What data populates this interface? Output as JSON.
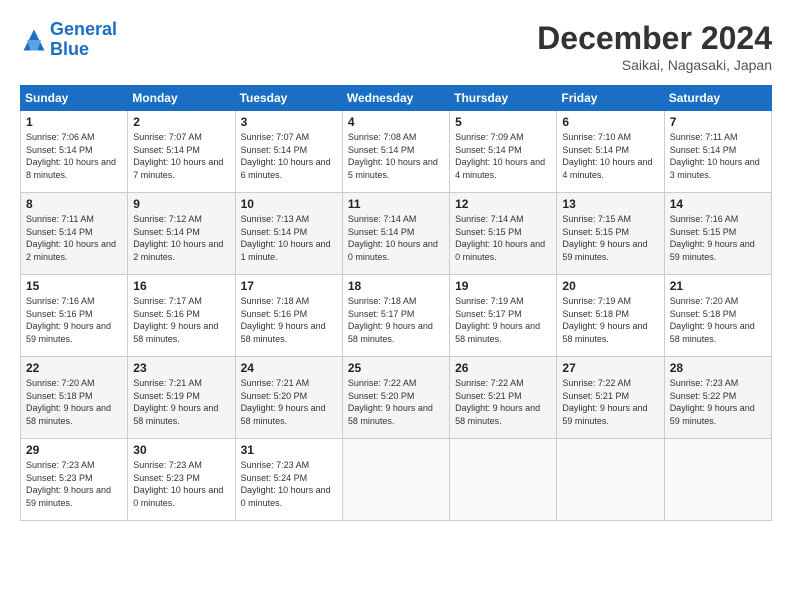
{
  "header": {
    "logo_line1": "General",
    "logo_line2": "Blue",
    "title": "December 2024",
    "location": "Saikai, Nagasaki, Japan"
  },
  "weekdays": [
    "Sunday",
    "Monday",
    "Tuesday",
    "Wednesday",
    "Thursday",
    "Friday",
    "Saturday"
  ],
  "weeks": [
    [
      {
        "day": "1",
        "sunrise": "Sunrise: 7:06 AM",
        "sunset": "Sunset: 5:14 PM",
        "daylight": "Daylight: 10 hours and 8 minutes."
      },
      {
        "day": "2",
        "sunrise": "Sunrise: 7:07 AM",
        "sunset": "Sunset: 5:14 PM",
        "daylight": "Daylight: 10 hours and 7 minutes."
      },
      {
        "day": "3",
        "sunrise": "Sunrise: 7:07 AM",
        "sunset": "Sunset: 5:14 PM",
        "daylight": "Daylight: 10 hours and 6 minutes."
      },
      {
        "day": "4",
        "sunrise": "Sunrise: 7:08 AM",
        "sunset": "Sunset: 5:14 PM",
        "daylight": "Daylight: 10 hours and 5 minutes."
      },
      {
        "day": "5",
        "sunrise": "Sunrise: 7:09 AM",
        "sunset": "Sunset: 5:14 PM",
        "daylight": "Daylight: 10 hours and 4 minutes."
      },
      {
        "day": "6",
        "sunrise": "Sunrise: 7:10 AM",
        "sunset": "Sunset: 5:14 PM",
        "daylight": "Daylight: 10 hours and 4 minutes."
      },
      {
        "day": "7",
        "sunrise": "Sunrise: 7:11 AM",
        "sunset": "Sunset: 5:14 PM",
        "daylight": "Daylight: 10 hours and 3 minutes."
      }
    ],
    [
      {
        "day": "8",
        "sunrise": "Sunrise: 7:11 AM",
        "sunset": "Sunset: 5:14 PM",
        "daylight": "Daylight: 10 hours and 2 minutes."
      },
      {
        "day": "9",
        "sunrise": "Sunrise: 7:12 AM",
        "sunset": "Sunset: 5:14 PM",
        "daylight": "Daylight: 10 hours and 2 minutes."
      },
      {
        "day": "10",
        "sunrise": "Sunrise: 7:13 AM",
        "sunset": "Sunset: 5:14 PM",
        "daylight": "Daylight: 10 hours and 1 minute."
      },
      {
        "day": "11",
        "sunrise": "Sunrise: 7:14 AM",
        "sunset": "Sunset: 5:14 PM",
        "daylight": "Daylight: 10 hours and 0 minutes."
      },
      {
        "day": "12",
        "sunrise": "Sunrise: 7:14 AM",
        "sunset": "Sunset: 5:15 PM",
        "daylight": "Daylight: 10 hours and 0 minutes."
      },
      {
        "day": "13",
        "sunrise": "Sunrise: 7:15 AM",
        "sunset": "Sunset: 5:15 PM",
        "daylight": "Daylight: 9 hours and 59 minutes."
      },
      {
        "day": "14",
        "sunrise": "Sunrise: 7:16 AM",
        "sunset": "Sunset: 5:15 PM",
        "daylight": "Daylight: 9 hours and 59 minutes."
      }
    ],
    [
      {
        "day": "15",
        "sunrise": "Sunrise: 7:16 AM",
        "sunset": "Sunset: 5:16 PM",
        "daylight": "Daylight: 9 hours and 59 minutes."
      },
      {
        "day": "16",
        "sunrise": "Sunrise: 7:17 AM",
        "sunset": "Sunset: 5:16 PM",
        "daylight": "Daylight: 9 hours and 58 minutes."
      },
      {
        "day": "17",
        "sunrise": "Sunrise: 7:18 AM",
        "sunset": "Sunset: 5:16 PM",
        "daylight": "Daylight: 9 hours and 58 minutes."
      },
      {
        "day": "18",
        "sunrise": "Sunrise: 7:18 AM",
        "sunset": "Sunset: 5:17 PM",
        "daylight": "Daylight: 9 hours and 58 minutes."
      },
      {
        "day": "19",
        "sunrise": "Sunrise: 7:19 AM",
        "sunset": "Sunset: 5:17 PM",
        "daylight": "Daylight: 9 hours and 58 minutes."
      },
      {
        "day": "20",
        "sunrise": "Sunrise: 7:19 AM",
        "sunset": "Sunset: 5:18 PM",
        "daylight": "Daylight: 9 hours and 58 minutes."
      },
      {
        "day": "21",
        "sunrise": "Sunrise: 7:20 AM",
        "sunset": "Sunset: 5:18 PM",
        "daylight": "Daylight: 9 hours and 58 minutes."
      }
    ],
    [
      {
        "day": "22",
        "sunrise": "Sunrise: 7:20 AM",
        "sunset": "Sunset: 5:18 PM",
        "daylight": "Daylight: 9 hours and 58 minutes."
      },
      {
        "day": "23",
        "sunrise": "Sunrise: 7:21 AM",
        "sunset": "Sunset: 5:19 PM",
        "daylight": "Daylight: 9 hours and 58 minutes."
      },
      {
        "day": "24",
        "sunrise": "Sunrise: 7:21 AM",
        "sunset": "Sunset: 5:20 PM",
        "daylight": "Daylight: 9 hours and 58 minutes."
      },
      {
        "day": "25",
        "sunrise": "Sunrise: 7:22 AM",
        "sunset": "Sunset: 5:20 PM",
        "daylight": "Daylight: 9 hours and 58 minutes."
      },
      {
        "day": "26",
        "sunrise": "Sunrise: 7:22 AM",
        "sunset": "Sunset: 5:21 PM",
        "daylight": "Daylight: 9 hours and 58 minutes."
      },
      {
        "day": "27",
        "sunrise": "Sunrise: 7:22 AM",
        "sunset": "Sunset: 5:21 PM",
        "daylight": "Daylight: 9 hours and 59 minutes."
      },
      {
        "day": "28",
        "sunrise": "Sunrise: 7:23 AM",
        "sunset": "Sunset: 5:22 PM",
        "daylight": "Daylight: 9 hours and 59 minutes."
      }
    ],
    [
      {
        "day": "29",
        "sunrise": "Sunrise: 7:23 AM",
        "sunset": "Sunset: 5:23 PM",
        "daylight": "Daylight: 9 hours and 59 minutes."
      },
      {
        "day": "30",
        "sunrise": "Sunrise: 7:23 AM",
        "sunset": "Sunset: 5:23 PM",
        "daylight": "Daylight: 10 hours and 0 minutes."
      },
      {
        "day": "31",
        "sunrise": "Sunrise: 7:23 AM",
        "sunset": "Sunset: 5:24 PM",
        "daylight": "Daylight: 10 hours and 0 minutes."
      },
      null,
      null,
      null,
      null
    ]
  ]
}
